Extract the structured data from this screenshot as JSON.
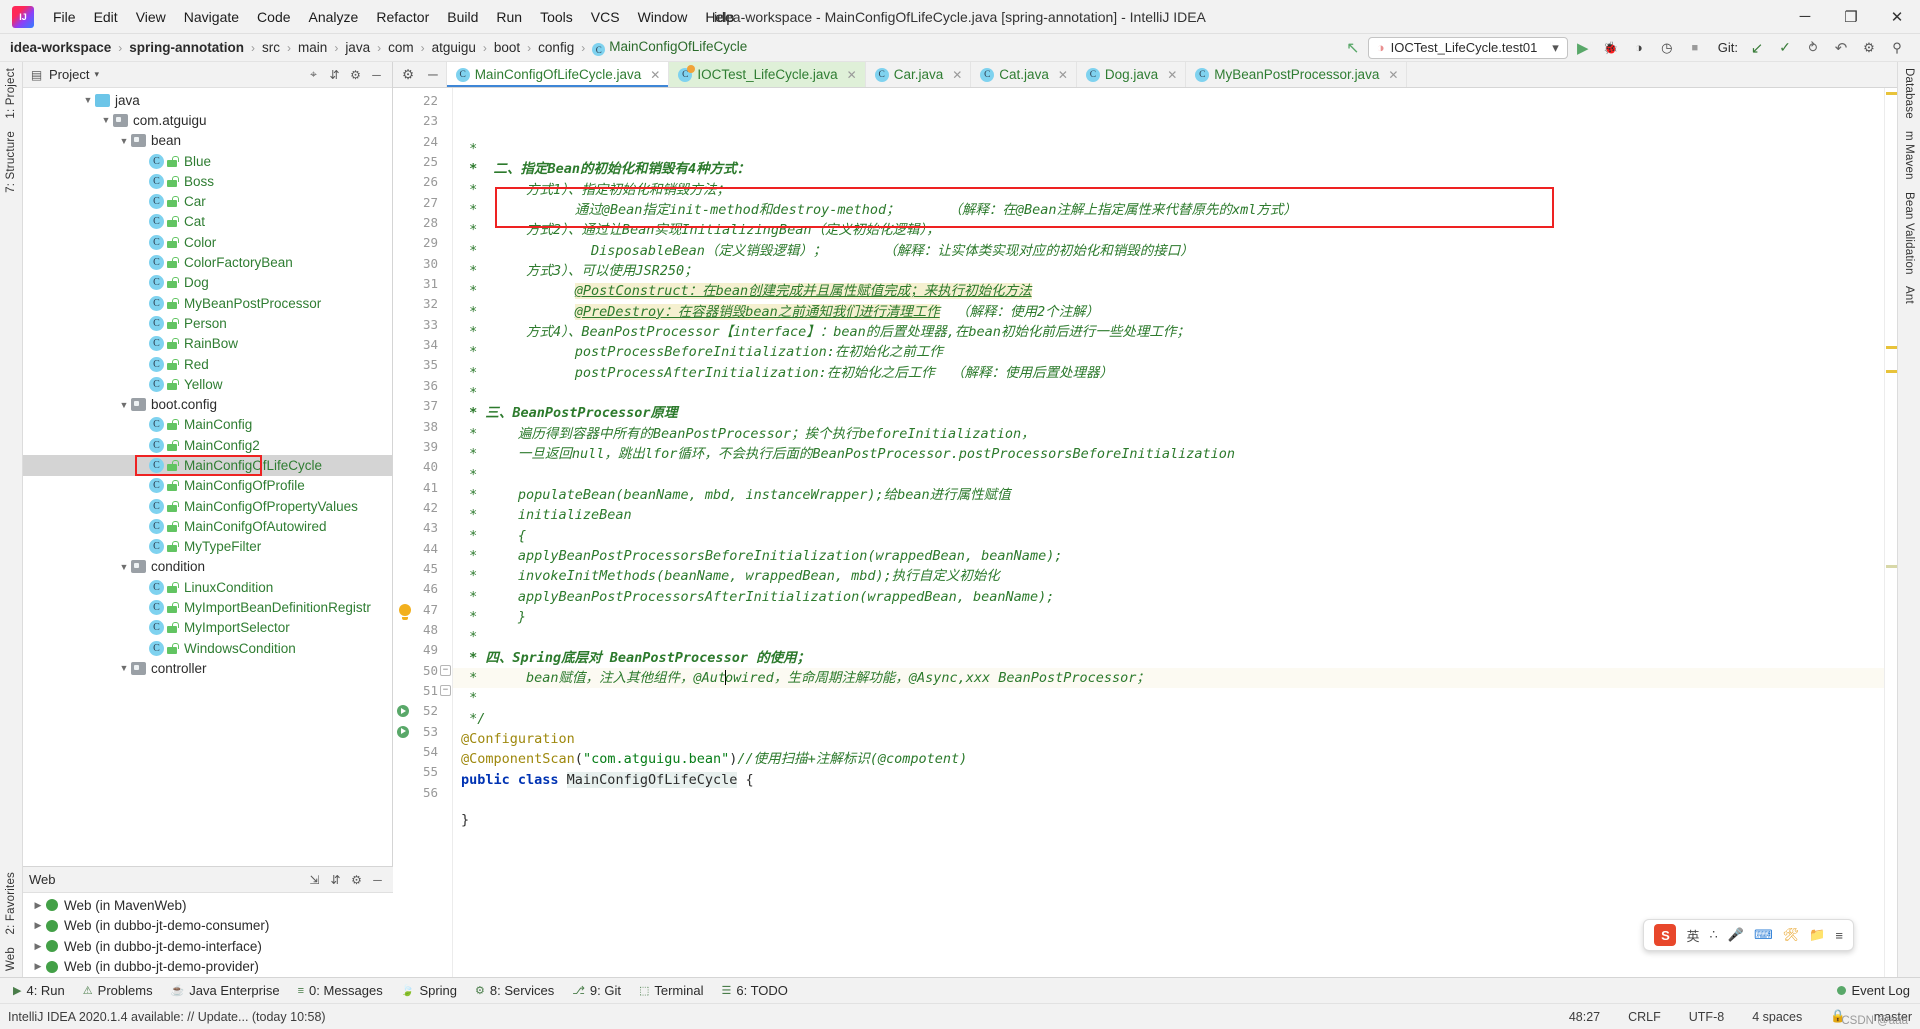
{
  "window": {
    "title": "idea-workspace - MainConfigOfLifeCycle.java [spring-annotation] - IntelliJ IDEA",
    "minimize": "─",
    "maximize": "❐",
    "close": "✕"
  },
  "menu": {
    "items": [
      "File",
      "Edit",
      "View",
      "Navigate",
      "Code",
      "Analyze",
      "Refactor",
      "Build",
      "Run",
      "Tools",
      "VCS",
      "Window",
      "Help"
    ]
  },
  "breadcrumb": {
    "items": [
      "idea-workspace",
      "spring-annotation",
      "src",
      "main",
      "java",
      "com",
      "atguigu",
      "boot",
      "config",
      "MainConfigOfLifeCycle"
    ],
    "separator": "›"
  },
  "toolbar": {
    "run_config": "IOCTest_LifeCycle.test01",
    "run_config_caret": "▾",
    "run_button": "▶",
    "debug_button": "🐞",
    "coverage_button": "◑",
    "profile_button": "◷",
    "stop_button": "■",
    "git_label": "Git:",
    "update_button": "↙",
    "commit_button": "✓",
    "history_button": "⥁",
    "rollback_button": "↶",
    "search_button": "⚲",
    "settings_button": "⚙",
    "up_arrow": "↖"
  },
  "left_rail": {
    "tabs": [
      "1: Project",
      "7: Structure"
    ],
    "bottom_tabs": [
      "2: Favorites",
      "Web"
    ]
  },
  "right_rail": {
    "tabs": [
      "Database",
      "m Maven",
      "Bean Validation",
      "Ant"
    ]
  },
  "project_panel": {
    "title": "Project",
    "caret": "▾",
    "locate_icon": "⌖",
    "collapse_icon": "⇵",
    "settings_icon": "⚙",
    "hide_icon": "─",
    "tree": [
      {
        "label": "java",
        "depth": 3,
        "kind": "folder-src",
        "twisty": "▼"
      },
      {
        "label": "com.atguigu",
        "depth": 4,
        "kind": "package",
        "twisty": "▼"
      },
      {
        "label": "bean",
        "depth": 5,
        "kind": "package",
        "twisty": "▼"
      },
      {
        "label": "Blue",
        "depth": 6,
        "kind": "class"
      },
      {
        "label": "Boss",
        "depth": 6,
        "kind": "class"
      },
      {
        "label": "Car",
        "depth": 6,
        "kind": "class"
      },
      {
        "label": "Cat",
        "depth": 6,
        "kind": "class"
      },
      {
        "label": "Color",
        "depth": 6,
        "kind": "class"
      },
      {
        "label": "ColorFactoryBean",
        "depth": 6,
        "kind": "class"
      },
      {
        "label": "Dog",
        "depth": 6,
        "kind": "class"
      },
      {
        "label": "MyBeanPostProcessor",
        "depth": 6,
        "kind": "class"
      },
      {
        "label": "Person",
        "depth": 6,
        "kind": "class"
      },
      {
        "label": "RainBow",
        "depth": 6,
        "kind": "class"
      },
      {
        "label": "Red",
        "depth": 6,
        "kind": "class"
      },
      {
        "label": "Yellow",
        "depth": 6,
        "kind": "class"
      },
      {
        "label": "boot.config",
        "depth": 5,
        "kind": "package",
        "twisty": "▼"
      },
      {
        "label": "MainConfig",
        "depth": 6,
        "kind": "class"
      },
      {
        "label": "MainConfig2",
        "depth": 6,
        "kind": "class"
      },
      {
        "label": "MainConfigOfLifeCycle",
        "depth": 6,
        "kind": "class",
        "selected": true,
        "boxed": true
      },
      {
        "label": "MainConfigOfProfile",
        "depth": 6,
        "kind": "class"
      },
      {
        "label": "MainConfigOfPropertyValues",
        "depth": 6,
        "kind": "class"
      },
      {
        "label": "MainConifgOfAutowired",
        "depth": 6,
        "kind": "class"
      },
      {
        "label": "MyTypeFilter",
        "depth": 6,
        "kind": "class"
      },
      {
        "label": "condition",
        "depth": 5,
        "kind": "package",
        "twisty": "▼"
      },
      {
        "label": "LinuxCondition",
        "depth": 6,
        "kind": "class"
      },
      {
        "label": "MyImportBeanDefinitionRegistr",
        "depth": 6,
        "kind": "class"
      },
      {
        "label": "MyImportSelector",
        "depth": 6,
        "kind": "class"
      },
      {
        "label": "WindowsCondition",
        "depth": 6,
        "kind": "class"
      },
      {
        "label": "controller",
        "depth": 5,
        "kind": "package",
        "twisty": "▼"
      }
    ]
  },
  "web_panel": {
    "title": "Web",
    "expand_icon": "⇲",
    "collapse_icon": "⇵",
    "settings_icon": "⚙",
    "hide_icon": "─",
    "items": [
      {
        "label": "Web (in MavenWeb)",
        "twisty": "▶"
      },
      {
        "label": "Web (in dubbo-jt-demo-consumer)",
        "twisty": "▶"
      },
      {
        "label": "Web (in dubbo-jt-demo-interface)",
        "twisty": "▶"
      },
      {
        "label": "Web (in dubbo-jt-demo-provider)",
        "twisty": "▶"
      }
    ]
  },
  "editor_tabs": [
    {
      "label": "MainConfigOfLifeCycle.java",
      "active": true,
      "icon": "class-icon",
      "close": "✕"
    },
    {
      "label": "IOCTest_LifeCycle.java",
      "active": false,
      "runconf": true,
      "icon": "class-run-icon",
      "close": "✕"
    },
    {
      "label": "Car.java",
      "active": false,
      "icon": "class-icon",
      "close": "✕"
    },
    {
      "label": "Cat.java",
      "active": false,
      "icon": "class-icon",
      "close": "✕"
    },
    {
      "label": "Dog.java",
      "active": false,
      "icon": "class-icon",
      "close": "✕"
    },
    {
      "label": "MyBeanPostProcessor.java",
      "active": false,
      "icon": "class-icon",
      "close": "✕"
    }
  ],
  "code": {
    "first_line_number": 22,
    "lines": [
      {
        "n": 22,
        "segments": [
          {
            "t": " *",
            "c": "cmt"
          }
        ]
      },
      {
        "n": 23,
        "segments": [
          {
            "t": " *  二、指定Bean的初始化和销毁有4种方式：",
            "c": "cmt-b"
          }
        ]
      },
      {
        "n": 24,
        "segments": [
          {
            "t": " *      方式1）、指定初始化和销毁方法；",
            "c": "cmt"
          }
        ]
      },
      {
        "n": 25,
        "segments": [
          {
            "t": " *            通过@Bean指定init-method和destroy-method；      （解释：在@Bean注解上指定属性来代替原先的xml方式）",
            "c": "cmt"
          }
        ]
      },
      {
        "n": 26,
        "segments": [
          {
            "t": " *      方式2）、通过让Bean实现InitializingBean（定义初始化逻辑），",
            "c": "cmt"
          }
        ]
      },
      {
        "n": 27,
        "segments": [
          {
            "t": " *              DisposableBean（定义销毁逻辑）；       （解释：让实体类实现对应的初始化和销毁的接口）",
            "c": "cmt"
          }
        ]
      },
      {
        "n": 28,
        "segments": [
          {
            "t": " *      方式3）、可以使用JSR250；",
            "c": "cmt"
          }
        ]
      },
      {
        "n": 29,
        "segments": [
          {
            "t": " *            ",
            "c": "cmt"
          },
          {
            "t": "@PostConstruct：在bean创建完成并且属性赋值完成；来执行初始化方法",
            "c": "cmt hl-yellow"
          }
        ]
      },
      {
        "n": 30,
        "segments": [
          {
            "t": " *            ",
            "c": "cmt"
          },
          {
            "t": "@PreDestroy：在容器销毁bean之前通知我们进行清理工作",
            "c": "cmt hl-yellow"
          },
          {
            "t": "  （解释：使用2个注解）",
            "c": "cmt"
          }
        ]
      },
      {
        "n": 31,
        "segments": [
          {
            "t": " *      方式4）、BeanPostProcessor【interface】：bean的后置处理器,在bean初始化前后进行一些处理工作；",
            "c": "cmt"
          }
        ]
      },
      {
        "n": 32,
        "segments": [
          {
            "t": " *            postProcessBeforeInitialization:在初始化之前工作",
            "c": "cmt"
          }
        ]
      },
      {
        "n": 33,
        "segments": [
          {
            "t": " *            postProcessAfterInitialization:在初始化之后工作  （解释：使用后置处理器）",
            "c": "cmt"
          }
        ]
      },
      {
        "n": 34,
        "segments": [
          {
            "t": " *",
            "c": "cmt"
          }
        ]
      },
      {
        "n": 35,
        "segments": [
          {
            "t": " * 三、BeanPostProcessor原理",
            "c": "cmt-b"
          }
        ]
      },
      {
        "n": 36,
        "segments": [
          {
            "t": " *     遍历得到容器中所有的BeanPostProcessor；挨个执行beforeInitialization，",
            "c": "cmt"
          }
        ]
      },
      {
        "n": 37,
        "segments": [
          {
            "t": " *     一旦返回null，跳出lfor循环，不会执行后面的BeanPostProcessor.postProcessorsBeforeInitialization",
            "c": "cmt"
          }
        ]
      },
      {
        "n": 38,
        "segments": [
          {
            "t": " *",
            "c": "cmt"
          }
        ]
      },
      {
        "n": 39,
        "segments": [
          {
            "t": " *     populateBean(beanName, mbd, instanceWrapper);给bean进行属性赋值",
            "c": "cmt"
          }
        ]
      },
      {
        "n": 40,
        "segments": [
          {
            "t": " *     initializeBean",
            "c": "cmt"
          }
        ]
      },
      {
        "n": 41,
        "segments": [
          {
            "t": " *     {",
            "c": "cmt"
          }
        ]
      },
      {
        "n": 42,
        "segments": [
          {
            "t": " *     applyBeanPostProcessorsBeforeInitialization(wrappedBean, beanName);",
            "c": "cmt"
          }
        ]
      },
      {
        "n": 43,
        "segments": [
          {
            "t": " *     invokeInitMethods(beanName, wrappedBean, mbd);执行自定义初始化",
            "c": "cmt"
          }
        ]
      },
      {
        "n": 44,
        "segments": [
          {
            "t": " *     applyBeanPostProcessorsAfterInitialization(wrappedBean, beanName);",
            "c": "cmt"
          }
        ]
      },
      {
        "n": 45,
        "segments": [
          {
            "t": " *     }",
            "c": "cmt"
          }
        ]
      },
      {
        "n": 46,
        "segments": [
          {
            "t": " *",
            "c": "cmt"
          }
        ]
      },
      {
        "n": 47,
        "segments": [
          {
            "t": " * 四、Spring底层对 BeanPostProcessor 的使用；",
            "c": "cmt-b"
          }
        ],
        "bulb": true
      },
      {
        "n": 48,
        "segments": [
          {
            "t": " *      bean赋值，注入其他组件，@Aut",
            "c": "cmt"
          },
          {
            "t": "",
            "c": "caret"
          },
          {
            "t": "owired，生命周期注解功能，@Async,xxx BeanPostProcessor；",
            "c": "cmt"
          }
        ],
        "current": true
      },
      {
        "n": 49,
        "segments": [
          {
            "t": " *",
            "c": "cmt"
          }
        ]
      },
      {
        "n": 50,
        "segments": [
          {
            "t": " */",
            "c": "cmt"
          }
        ],
        "fold": "−"
      },
      {
        "n": 51,
        "segments": [
          {
            "t": "@Configuration",
            "c": "ann"
          }
        ],
        "fold": "−"
      },
      {
        "n": 52,
        "segments": [
          {
            "t": "@ComponentScan",
            "c": "ann"
          },
          {
            "t": "(",
            "c": ""
          },
          {
            "t": "\"com.atguigu.bean\"",
            "c": "str"
          },
          {
            "t": ")",
            "c": ""
          },
          {
            "t": "//使用扫描+注解标识(@compotent)",
            "c": "cmt"
          }
        ],
        "runmark": true
      },
      {
        "n": 53,
        "segments": [
          {
            "t": "public class ",
            "c": "kw"
          },
          {
            "t": "MainConfigOfLifeCycle",
            "c": "cls-name"
          },
          {
            "t": " {",
            "c": ""
          }
        ],
        "runmark": true
      },
      {
        "n": 54,
        "segments": [
          {
            "t": "",
            "c": ""
          }
        ]
      },
      {
        "n": 55,
        "segments": [
          {
            "t": "}",
            "c": ""
          }
        ]
      },
      {
        "n": 56,
        "segments": [
          {
            "t": "",
            "c": ""
          }
        ]
      }
    ]
  },
  "bottom_tools": [
    {
      "label": "4: Run",
      "icon": "▶"
    },
    {
      "label": "Problems",
      "icon": "⚠"
    },
    {
      "label": "Java Enterprise",
      "icon": "☕"
    },
    {
      "label": "0: Messages",
      "icon": "≡"
    },
    {
      "label": "Spring",
      "icon": "🍃"
    },
    {
      "label": "8: Services",
      "icon": "⚙"
    },
    {
      "label": "9: Git",
      "icon": "⎇"
    },
    {
      "label": "Terminal",
      "icon": "⬚"
    },
    {
      "label": "6: TODO",
      "icon": "☰"
    }
  ],
  "event_log": "Event Log",
  "status": {
    "message": "IntelliJ IDEA 2020.1.4 available: // Update... (today 10:58)",
    "caret_position": "48:27",
    "line_separator": "CRLF",
    "encoding": "UTF-8",
    "indent": "4 spaces",
    "branch": "master",
    "lock_icon": "🔒"
  },
  "ime": {
    "logo": "S",
    "mode": "英",
    "tools": [
      "∴",
      "🎤",
      "⌨",
      "🛠",
      "📁",
      "≡"
    ]
  },
  "watermark": "CSDN @aaa",
  "colors": {
    "accent_green": "#59a869",
    "comment_green": "#2c7a2c",
    "annotation": "#9e880d",
    "keyword_blue": "#0033b3",
    "highlight_red": "#ee2222",
    "tab_active_blue": "#3e86d6",
    "selection_gray": "#d4d4d4",
    "runconf_tab_green": "#dff0d8"
  }
}
